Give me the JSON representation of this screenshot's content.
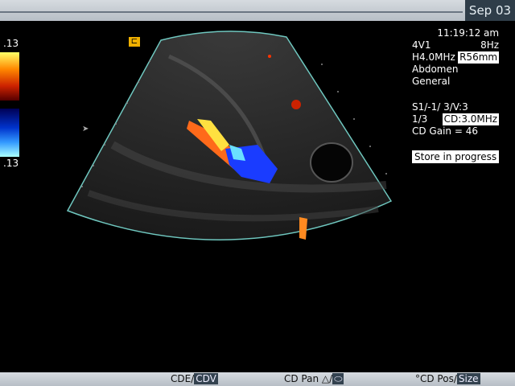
{
  "header": {
    "date": "Sep 03"
  },
  "scale": {
    "top_label": ".13",
    "bottom_label": ".13"
  },
  "info": {
    "time": "11:19:12 am",
    "probe": "4V1",
    "frame_rate": "8Hz",
    "harmonic_freq": "H4.0MHz",
    "range": "R56mm",
    "preset": "Abdomen",
    "preset_sub": "General",
    "settings_line": "S1/-1/ 3/V:3",
    "ratio": "1/3",
    "cd_freq": "CD:3.0MHz",
    "cd_gain": "CD Gain = 46",
    "store_status": "Store in progress"
  },
  "icons": {
    "marker": "probe-orientation-marker-icon"
  },
  "bottom": {
    "cde": "CDE/",
    "cdv": "CDV",
    "cd_pan": "CD Pan",
    "cd_pos": "CD Pos/",
    "size": "Size"
  },
  "colors": {
    "frame": "#6fc7bf",
    "toolbar": "#c5ccd3",
    "date_bg": "#2f3d49"
  }
}
